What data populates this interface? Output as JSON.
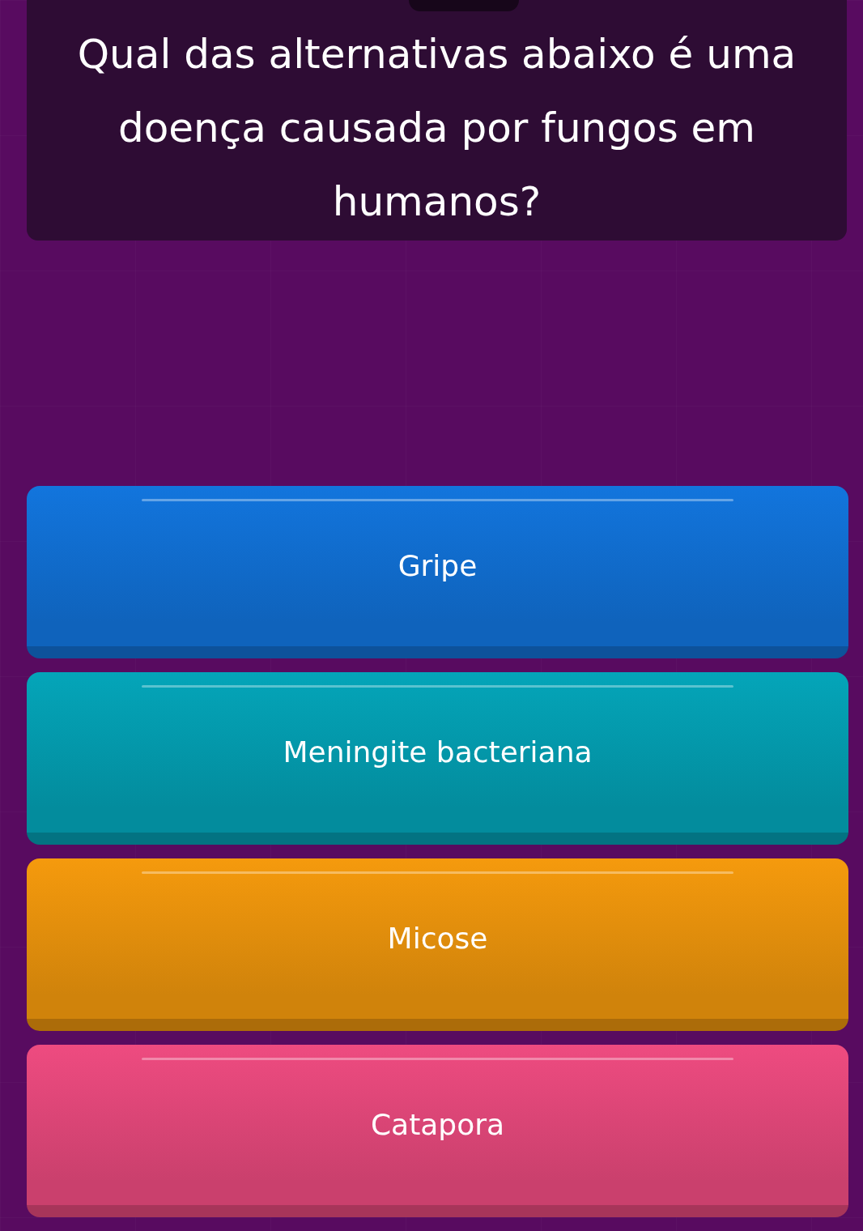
{
  "question": {
    "text": "Qual das alternativas abaixo é uma doença causada por fungos em humanos?"
  },
  "options": [
    {
      "label": "Gripe",
      "color": "#1275dd"
    },
    {
      "label": "Meningite bacteriana",
      "color": "#04a5b9"
    },
    {
      "label": "Micose",
      "color": "#f59a0d"
    },
    {
      "label": "Catapora",
      "color": "#ee4b80"
    }
  ]
}
